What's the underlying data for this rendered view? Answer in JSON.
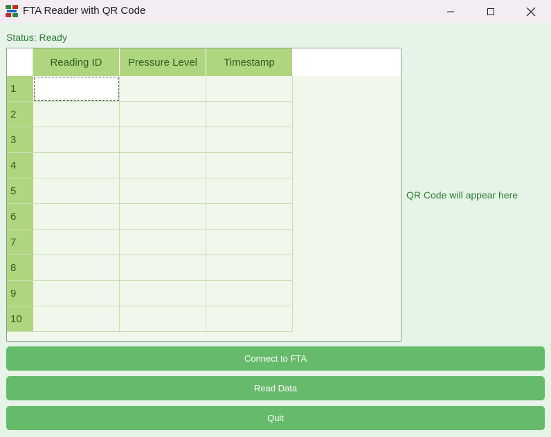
{
  "window": {
    "title": "FTA Reader with QR Code",
    "icon": "app-logo-icon"
  },
  "status": {
    "text": "Status: Ready"
  },
  "table": {
    "columns": [
      "Reading ID",
      "Pressure Level",
      "Timestamp"
    ],
    "row_headers": [
      "1",
      "2",
      "3",
      "4",
      "5",
      "6",
      "7",
      "8",
      "9",
      "10"
    ],
    "rows": [
      [
        "",
        "",
        ""
      ],
      [
        "",
        "",
        ""
      ],
      [
        "",
        "",
        ""
      ],
      [
        "",
        "",
        ""
      ],
      [
        "",
        "",
        ""
      ],
      [
        "",
        "",
        ""
      ],
      [
        "",
        "",
        ""
      ],
      [
        "",
        "",
        ""
      ],
      [
        "",
        "",
        ""
      ],
      [
        "",
        "",
        ""
      ]
    ]
  },
  "qr": {
    "placeholder": "QR Code will appear here"
  },
  "buttons": {
    "connect": "Connect to FTA",
    "read": "Read Data",
    "quit": "Quit"
  },
  "colors": {
    "header_green": "#afd67e",
    "button_green": "#66bb6a",
    "status_text": "#2e7d32",
    "background": "#e6f4e8"
  }
}
